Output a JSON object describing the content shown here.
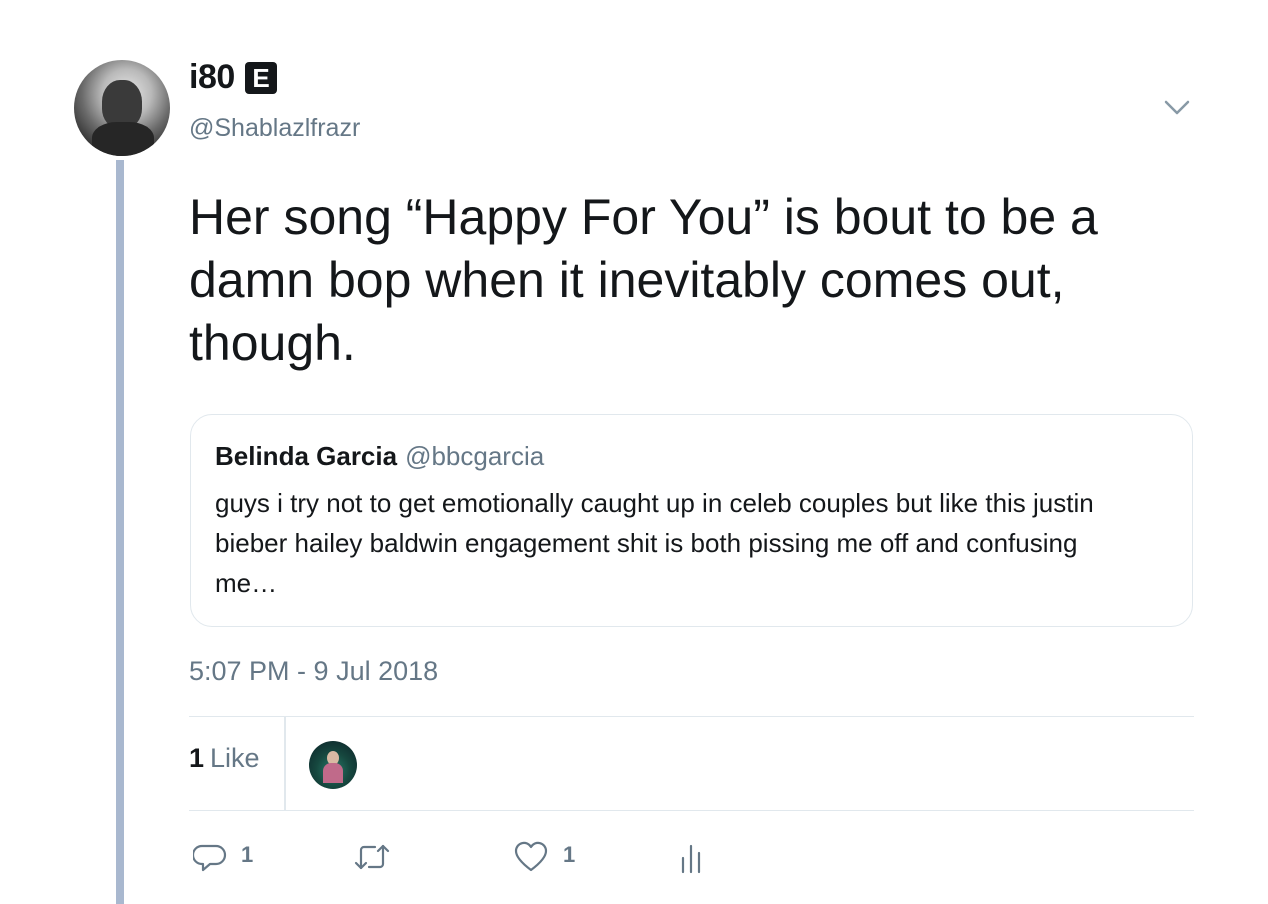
{
  "tweet": {
    "display_name": "i80",
    "badge": "E",
    "handle": "@Shablazlfrazr",
    "text": "Her song “Happy For You” is bout to be a damn bop when it inevitably comes out, though.",
    "timestamp": "5:07 PM - 9 Jul 2018"
  },
  "quoted_tweet": {
    "name": "Belinda Garcia",
    "handle": "@bbcgarcia",
    "text": "guys i try not to get emotionally caught up in celeb couples but like this justin bieber hailey baldwin engagement shit is both pissing me off and confusing me…"
  },
  "stats": {
    "likes_number": "1",
    "likes_label": "Like"
  },
  "actions": {
    "reply_count": "1",
    "retweet_count": "",
    "like_count": "1"
  },
  "icons": {
    "menu": "chevron-down-icon",
    "reply": "reply-icon",
    "retweet": "retweet-icon",
    "like": "heart-icon",
    "analytics": "analytics-icon"
  },
  "colors": {
    "thread_line": "#a9b8cf",
    "secondary_text": "#657786",
    "border": "#e1e8ed"
  }
}
